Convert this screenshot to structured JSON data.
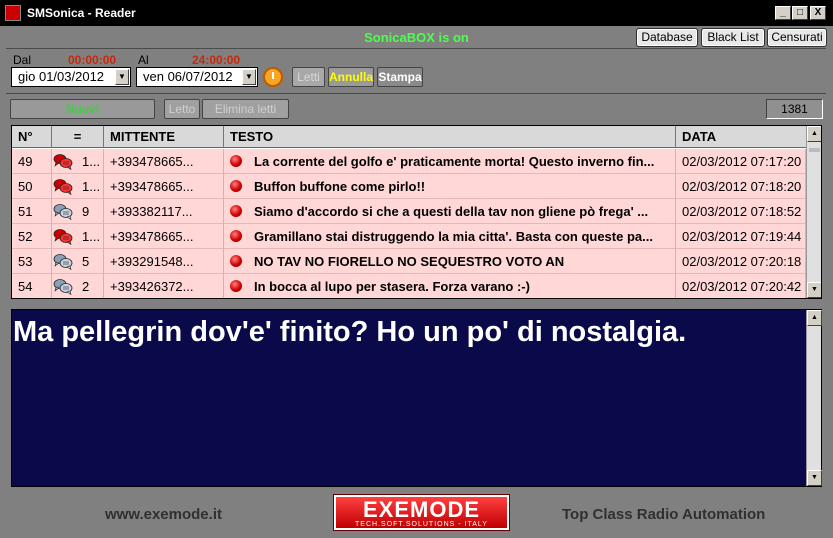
{
  "window": {
    "title": "SMSonica - Reader",
    "min": "_",
    "max": "□",
    "close": "X"
  },
  "status": "SonicaBOX is on",
  "top_buttons": {
    "database": "Database",
    "blacklist": "Black List",
    "censurati": "Censurati"
  },
  "filters": {
    "dal_label": "Dal",
    "dal_time": "00:00:00",
    "dal_date": "gio  01/03/2012",
    "al_label": "Al",
    "al_time": "24:00:00",
    "al_date": "ven  06/07/2012",
    "letti": "Letti",
    "annulla": "Annulla",
    "stampa": "Stampa"
  },
  "actions": {
    "nuovi": "Nuovi",
    "letto": "Letto",
    "elimina": "Elimina letti",
    "count": "1381"
  },
  "table": {
    "headers": [
      "N°",
      "=",
      "MITTENTE",
      "TESTO",
      "DATA"
    ],
    "rows": [
      {
        "n": "49",
        "count": "1...",
        "sender": "+393478665...",
        "text": "La corrente del golfo e' praticamente morta! Questo inverno fin...",
        "date": "02/03/2012 07:17:20",
        "icon": "red"
      },
      {
        "n": "50",
        "count": "1...",
        "sender": "+393478665...",
        "text": "Buffon buffone come pirlo!!",
        "date": "02/03/2012 07:18:20",
        "icon": "red"
      },
      {
        "n": "51",
        "count": "9",
        "sender": "+393382117...",
        "text": "Siamo d'accordo si che a questi della tav non gliene pò frega' ...",
        "date": "02/03/2012 07:18:52",
        "icon": "grey"
      },
      {
        "n": "52",
        "count": "1...",
        "sender": "+393478665...",
        "text": "Gramillano stai distruggendo la mia citta'. Basta con queste pa...",
        "date": "02/03/2012 07:19:44",
        "icon": "red"
      },
      {
        "n": "53",
        "count": "5",
        "sender": "+393291548...",
        "text": "NO TAV NO FIORELLO NO SEQUESTRO VOTO AN",
        "date": "02/03/2012 07:20:18",
        "icon": "grey"
      },
      {
        "n": "54",
        "count": "2",
        "sender": "+393426372...",
        "text": "In bocca al lupo per stasera. Forza varano :-)",
        "date": "02/03/2012 07:20:42",
        "icon": "grey"
      }
    ]
  },
  "message": "Ma pellegrin dov'e' finito? Ho un po' di nostalgia.",
  "footer": {
    "site": "www.exemode.it",
    "logo": "EXEMODE",
    "logo_sub": "TECH.SOFT.SOLUTIONS - ITALY",
    "slogan": "Top Class Radio Automation"
  },
  "colors": {
    "status_green": "#4cff4c",
    "time_red": "#c8280a",
    "row_pink": "#ffd7d7",
    "message_bg": "#0a0a4a"
  }
}
